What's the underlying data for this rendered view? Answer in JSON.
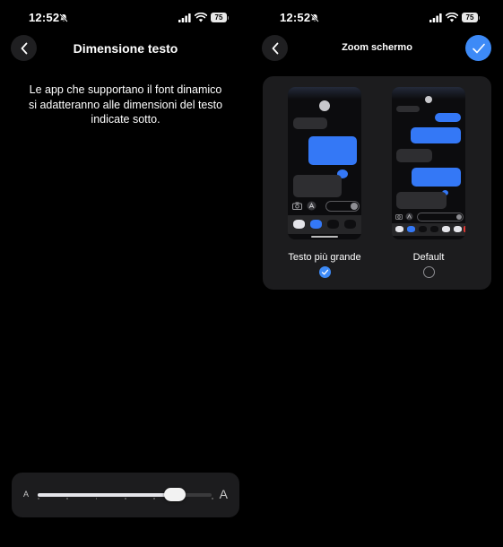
{
  "left": {
    "status": {
      "time": "12:52",
      "battery": "75"
    },
    "nav": {
      "title": "Dimensione testo"
    },
    "description": "Le app che supportano il font dinamico si adatteranno alle dimensioni del testo indicate sotto.",
    "slider": {
      "small_label": "A",
      "large_label": "A",
      "value_fraction": 0.79,
      "steps": 7
    }
  },
  "right": {
    "status": {
      "time": "12:52",
      "battery": "75"
    },
    "nav": {
      "title": "Zoom schermo"
    },
    "options": [
      {
        "label": "Testo più grande",
        "selected": true
      },
      {
        "label": "Default",
        "selected": false
      }
    ]
  },
  "colors": {
    "accent": "#3d8af7",
    "card": "#1c1c1e",
    "background": "#000000"
  },
  "icons": {
    "back": "chevron-left-icon",
    "confirm": "checkmark-icon",
    "silent": "bell-slash-icon",
    "signal": "cellular-signal-icon",
    "wifi": "wifi-icon"
  }
}
